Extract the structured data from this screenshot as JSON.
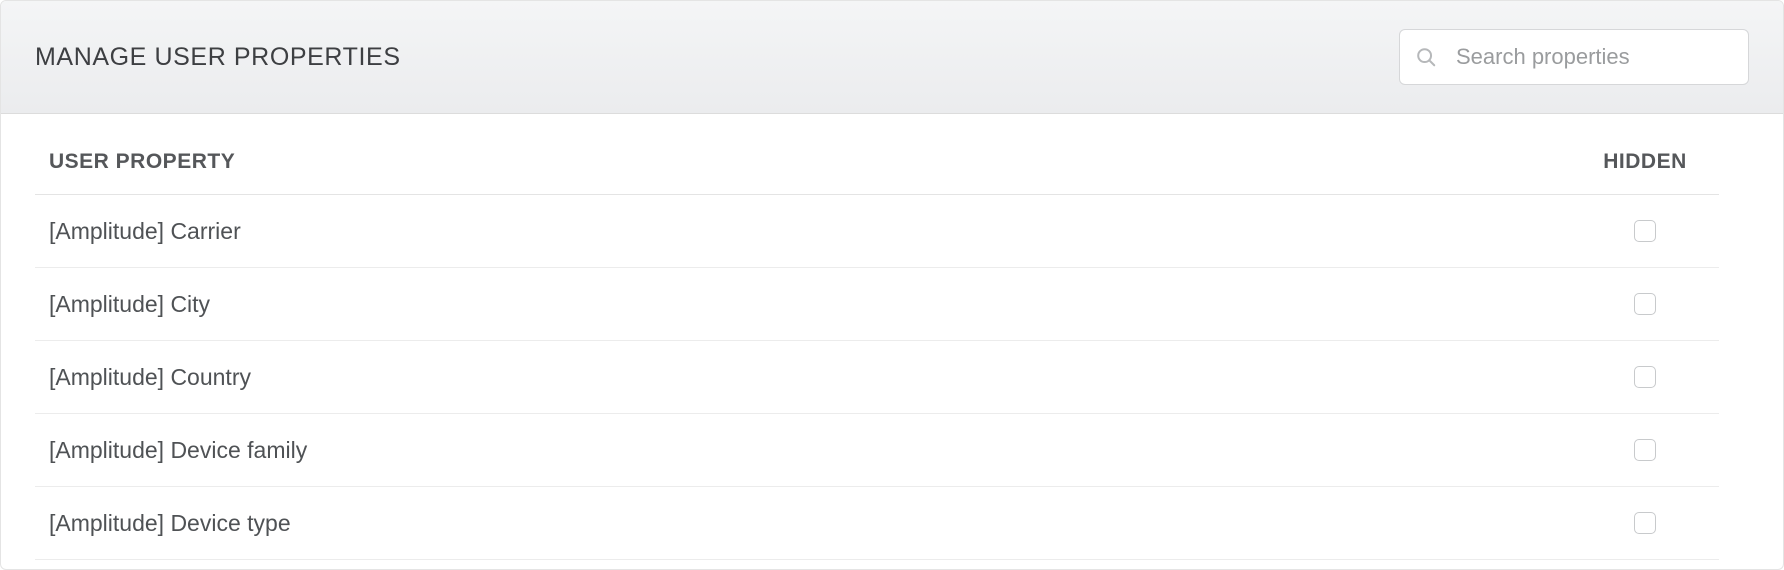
{
  "header": {
    "title": "MANAGE USER PROPERTIES",
    "search_placeholder": "Search properties"
  },
  "table": {
    "columns": {
      "name": "USER PROPERTY",
      "hidden": "HIDDEN"
    },
    "rows": [
      {
        "name": "[Amplitude] Carrier",
        "hidden": false
      },
      {
        "name": "[Amplitude] City",
        "hidden": false
      },
      {
        "name": "[Amplitude] Country",
        "hidden": false
      },
      {
        "name": "[Amplitude] Device family",
        "hidden": false
      },
      {
        "name": "[Amplitude] Device type",
        "hidden": false
      }
    ]
  }
}
